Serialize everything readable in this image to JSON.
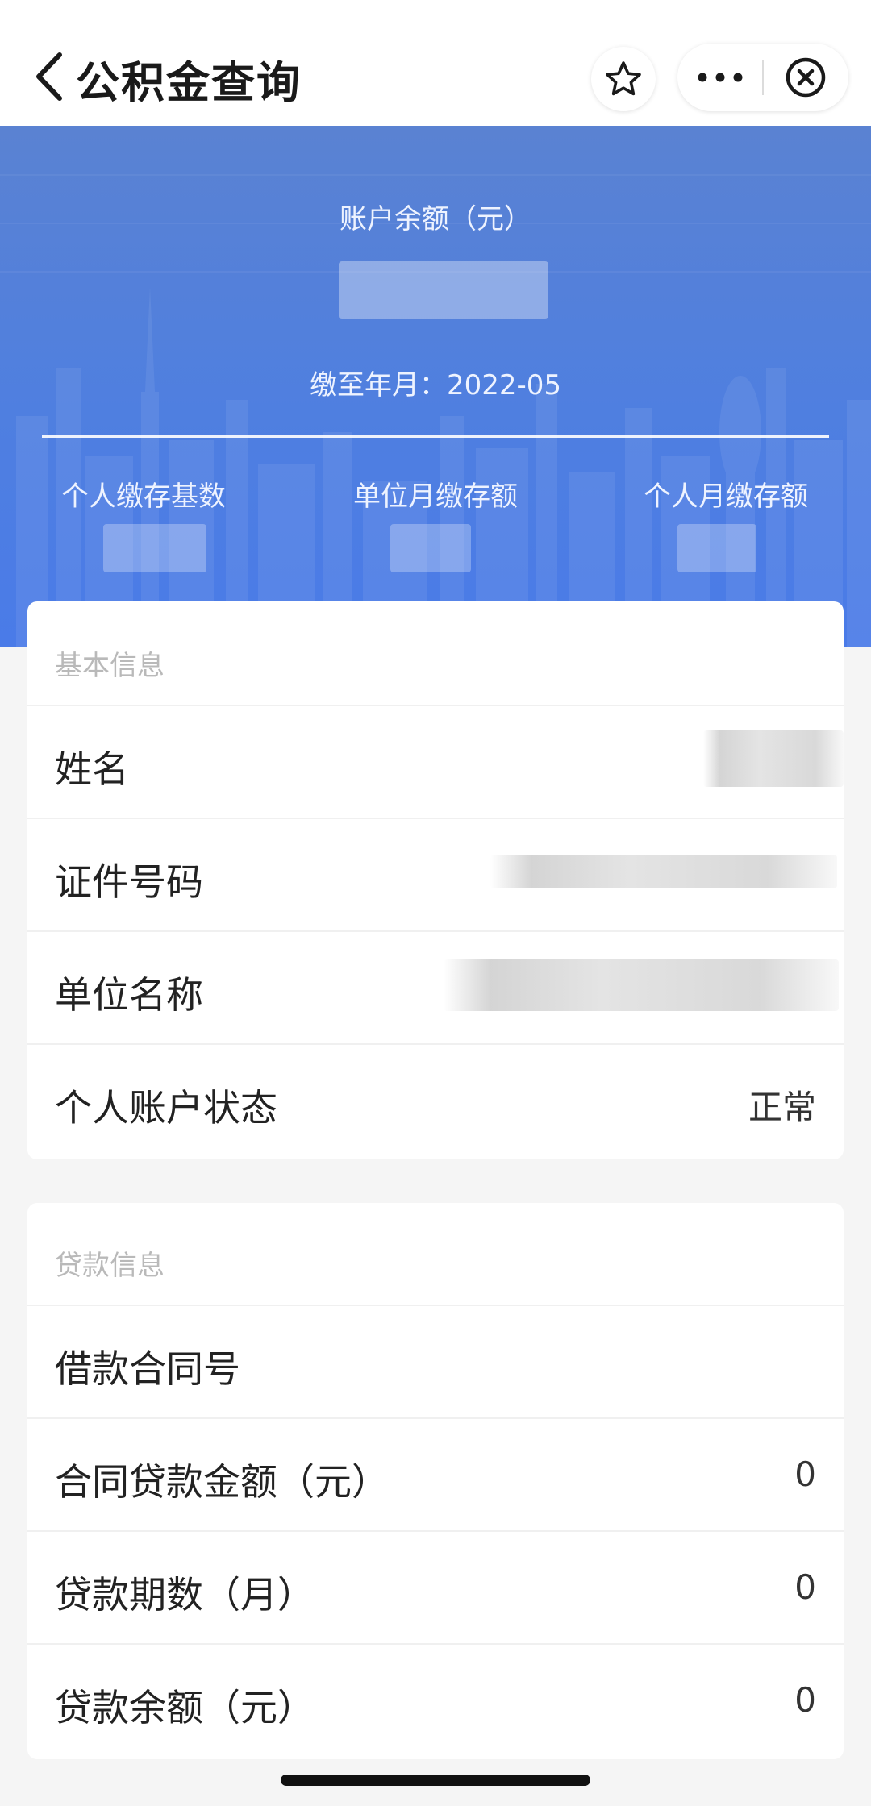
{
  "navbar": {
    "title": "公积金查询",
    "back_icon": "chevron-left-icon",
    "favorite_icon": "star-icon",
    "more_icon": "more-dots-icon",
    "close_icon": "close-circle-icon"
  },
  "summary": {
    "balance_label": "账户余额（元）",
    "due_date": "缴至年月：2022-05",
    "stats": [
      {
        "label": "个人缴存基数"
      },
      {
        "label": "单位月缴存额"
      },
      {
        "label": "个人月缴存额"
      }
    ]
  },
  "basic_info": {
    "heading": "基本信息",
    "rows": [
      {
        "label": "姓名",
        "value": ""
      },
      {
        "label": "证件号码",
        "value": ""
      },
      {
        "label": "单位名称",
        "value": ""
      },
      {
        "label": "个人账户状态",
        "value": "正常"
      }
    ]
  },
  "loan_info": {
    "heading": "贷款信息",
    "rows": [
      {
        "label": "借款合同号",
        "value": ""
      },
      {
        "label": "合同贷款金额（元）",
        "value": "0"
      },
      {
        "label": "贷款期数（月）",
        "value": "0"
      },
      {
        "label": "贷款余额（元）",
        "value": "0"
      }
    ]
  },
  "colors": {
    "header_blue": "#4f7fe0",
    "background": "#f5f5f5"
  }
}
